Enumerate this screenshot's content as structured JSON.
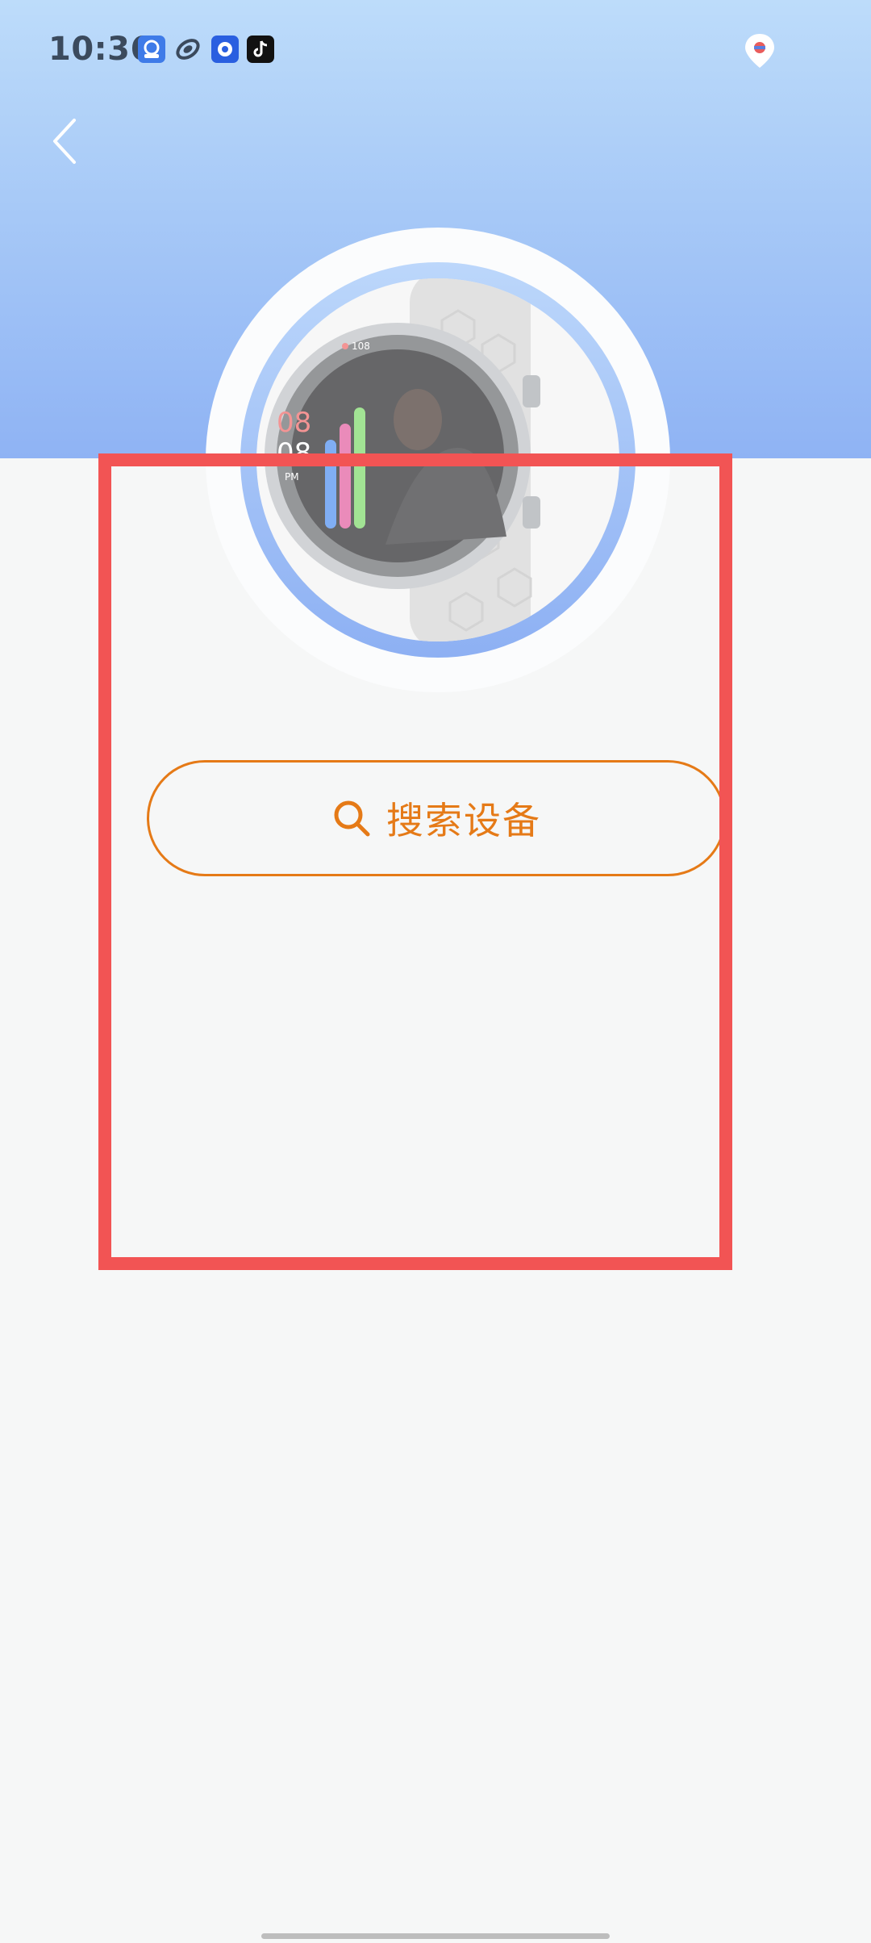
{
  "status_bar": {
    "time": "10:36",
    "notification_icons": [
      "app-notification-icon",
      "swirl-app-icon",
      "chat-app-icon",
      "tiktok-icon"
    ],
    "location_icon": "location-pin-icon"
  },
  "nav": {
    "back_icon": "chevron-left-icon"
  },
  "device_image": {
    "icon": "smartwatch-image",
    "watch_face": {
      "heart_rate": "108",
      "hour": "08",
      "minute": "08",
      "period": "PM"
    }
  },
  "search_button": {
    "icon": "search-icon",
    "label": "搜索设备"
  },
  "colors": {
    "header_gradient_top": "#bddcfa",
    "header_gradient_bottom": "#8fb3f4",
    "accent_orange": "#e57a17",
    "highlight_red": "#f25454",
    "page_background": "#f6f7f7"
  }
}
